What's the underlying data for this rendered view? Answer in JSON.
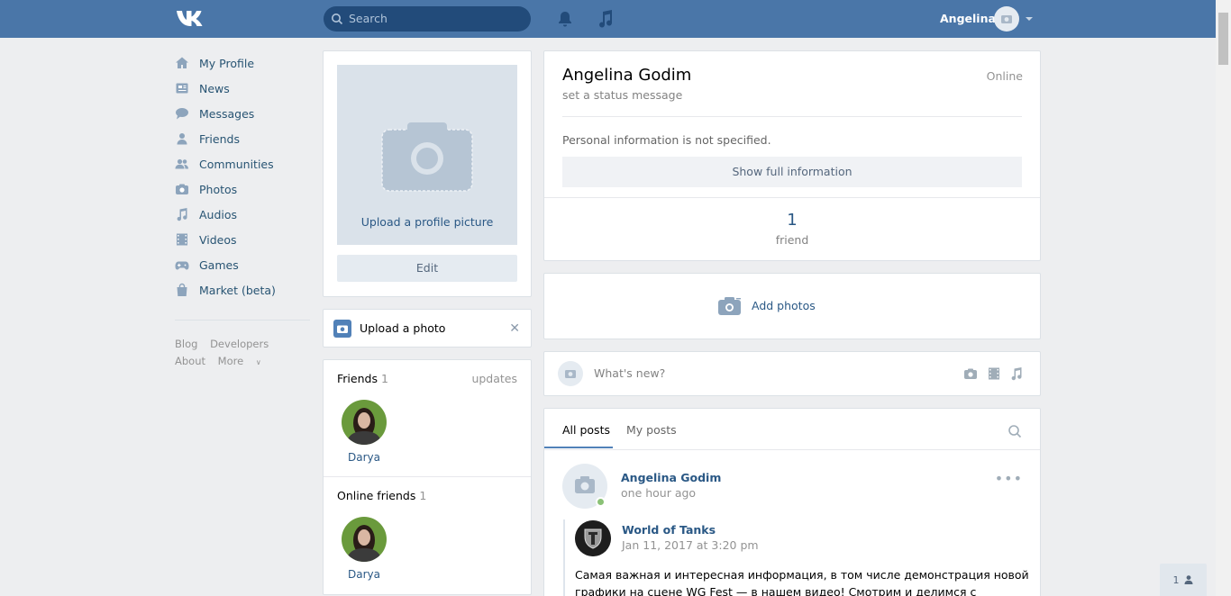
{
  "topbar": {
    "logo": "vk-logo",
    "search_placeholder": "Search",
    "user_name": "Angelina"
  },
  "nav": {
    "items": [
      {
        "label": "My Profile",
        "icon": "home-icon"
      },
      {
        "label": "News",
        "icon": "news-icon"
      },
      {
        "label": "Messages",
        "icon": "messages-icon"
      },
      {
        "label": "Friends",
        "icon": "friend-icon"
      },
      {
        "label": "Communities",
        "icon": "communities-icon"
      },
      {
        "label": "Photos",
        "icon": "camera-icon"
      },
      {
        "label": "Audios",
        "icon": "music-icon"
      },
      {
        "label": "Videos",
        "icon": "film-icon"
      },
      {
        "label": "Games",
        "icon": "gamepad-icon"
      },
      {
        "label": "Market (beta)",
        "icon": "bag-icon"
      }
    ],
    "footer": {
      "blog": "Blog",
      "developers": "Developers",
      "about": "About",
      "more": "More"
    }
  },
  "profile_photo": {
    "upload_label": "Upload a profile picture",
    "edit_label": "Edit"
  },
  "upload_photo": {
    "label": "Upload a photo"
  },
  "friends": {
    "title": "Friends",
    "count": "1",
    "updates": "updates",
    "items": [
      {
        "name": "Darya"
      }
    ]
  },
  "online_friends": {
    "title": "Online friends",
    "count": "1",
    "items": [
      {
        "name": "Darya"
      }
    ]
  },
  "info": {
    "name": "Angelina Godim",
    "status": "set a status message",
    "online": "Online",
    "personal": "Personal information is not specified.",
    "show_full": "Show full information",
    "friend_count": "1",
    "friend_label": "friend"
  },
  "add_photos": {
    "label": "Add photos"
  },
  "whats_new": {
    "placeholder": "What's new?"
  },
  "wall": {
    "tabs": [
      {
        "label": "All posts"
      },
      {
        "label": "My posts"
      }
    ],
    "post": {
      "author": "Angelina Godim",
      "time": "one hour ago",
      "repost": {
        "author": "World of Tanks",
        "time": "Jan 11, 2017 at 3:20 pm",
        "text": "Самая важная и интересная информация, в том числе демонстрация новой графики на сцене WG Fest — в нашем видео! Смотрим и делимся с друзьями!"
      }
    }
  },
  "fab": {
    "count": "1"
  },
  "colors": {
    "header": "#4a76a8",
    "link": "#2a5885",
    "background": "#edeef0",
    "online": "#8ac176"
  }
}
